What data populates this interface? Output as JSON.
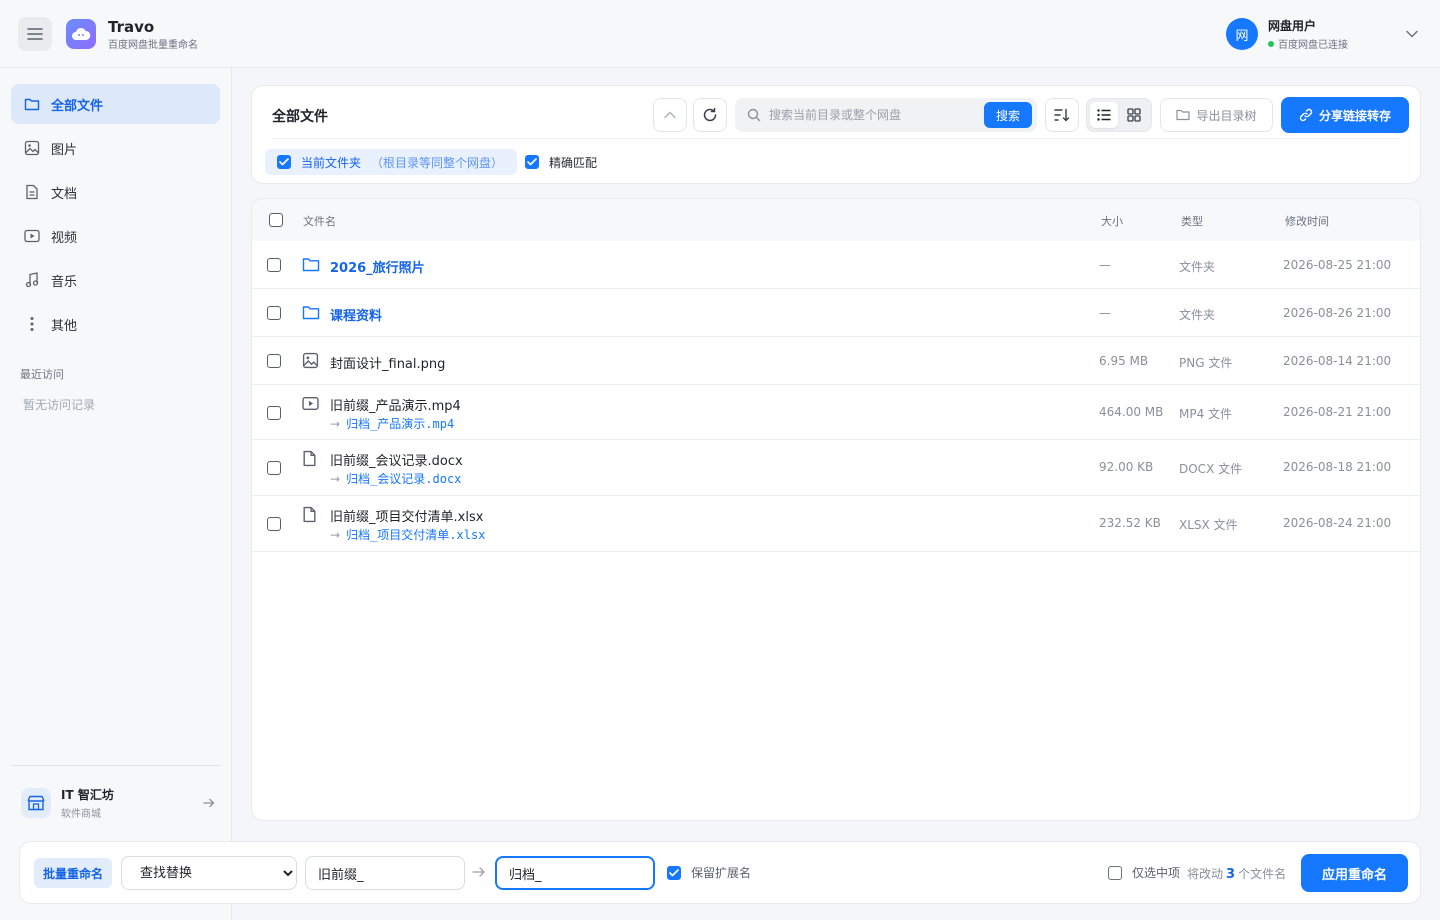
{
  "header": {
    "app_name": "Travo",
    "app_subtitle": "百度网盘批量重命名",
    "user_avatar": "网",
    "user_name": "网盘用户",
    "user_status": "百度网盘已连接"
  },
  "sidebar": {
    "items": [
      {
        "label": "全部文件",
        "icon": "folder-icon",
        "active": true
      },
      {
        "label": "图片",
        "icon": "image-icon",
        "active": false
      },
      {
        "label": "文档",
        "icon": "document-icon",
        "active": false
      },
      {
        "label": "视频",
        "icon": "video-icon",
        "active": false
      },
      {
        "label": "音乐",
        "icon": "music-icon",
        "active": false
      },
      {
        "label": "其他",
        "icon": "more-icon",
        "active": false
      }
    ],
    "recent_title": "最近访问",
    "recent_empty": "暂无访问记录",
    "store_name": "IT 智汇坊",
    "store_subtitle": "软件商城"
  },
  "toolbar": {
    "title": "全部文件",
    "search_placeholder": "搜索当前目录或整个网盘",
    "search_button": "搜索",
    "export_label": "导出目录树",
    "share_label": "分享链接转存",
    "scope_label": "当前文件夹",
    "scope_hint": "（根目录等同整个网盘）",
    "exact_label": "精确匹配"
  },
  "table": {
    "headers": {
      "name": "文件名",
      "size": "大小",
      "type": "类型",
      "mtime": "修改时间"
    },
    "rows": [
      {
        "name": "2026_旅行照片",
        "new_name": "",
        "size": "—",
        "type": "文件夹",
        "mtime": "2026-08-25 21:00",
        "kind": "folder"
      },
      {
        "name": "课程资料",
        "new_name": "",
        "size": "—",
        "type": "文件夹",
        "mtime": "2026-08-26 21:00",
        "kind": "folder"
      },
      {
        "name": "封面设计_final.png",
        "new_name": "",
        "size": "6.95 MB",
        "type": "PNG 文件",
        "mtime": "2026-08-14 21:00",
        "kind": "image"
      },
      {
        "name": "旧前缀_产品演示.mp4",
        "new_name": "归档_产品演示.mp4",
        "size": "464.00 MB",
        "type": "MP4 文件",
        "mtime": "2026-08-21 21:00",
        "kind": "video"
      },
      {
        "name": "旧前缀_会议记录.docx",
        "new_name": "归档_会议记录.docx",
        "size": "92.00 KB",
        "type": "DOCX 文件",
        "mtime": "2026-08-18 21:00",
        "kind": "file"
      },
      {
        "name": "旧前缀_项目交付清单.xlsx",
        "new_name": "归档_项目交付清单.xlsx",
        "size": "232.52 KB",
        "type": "XLSX 文件",
        "mtime": "2026-08-24 21:00",
        "kind": "file"
      }
    ]
  },
  "rename_bar": {
    "mode_tag": "批量重命名",
    "mode_selected": "查找替换",
    "find_value": "旧前缀_",
    "replace_value": "归档_",
    "keep_ext_label": "保留扩展名",
    "only_selected_label": "仅选中项",
    "count_prefix": "将改动",
    "count_value": "3",
    "count_suffix": "个文件名",
    "apply_label": "应用重命名"
  },
  "colors": {
    "accent": "#1677ff",
    "active_bg": "#dde8fb",
    "online": "#22c55e"
  }
}
